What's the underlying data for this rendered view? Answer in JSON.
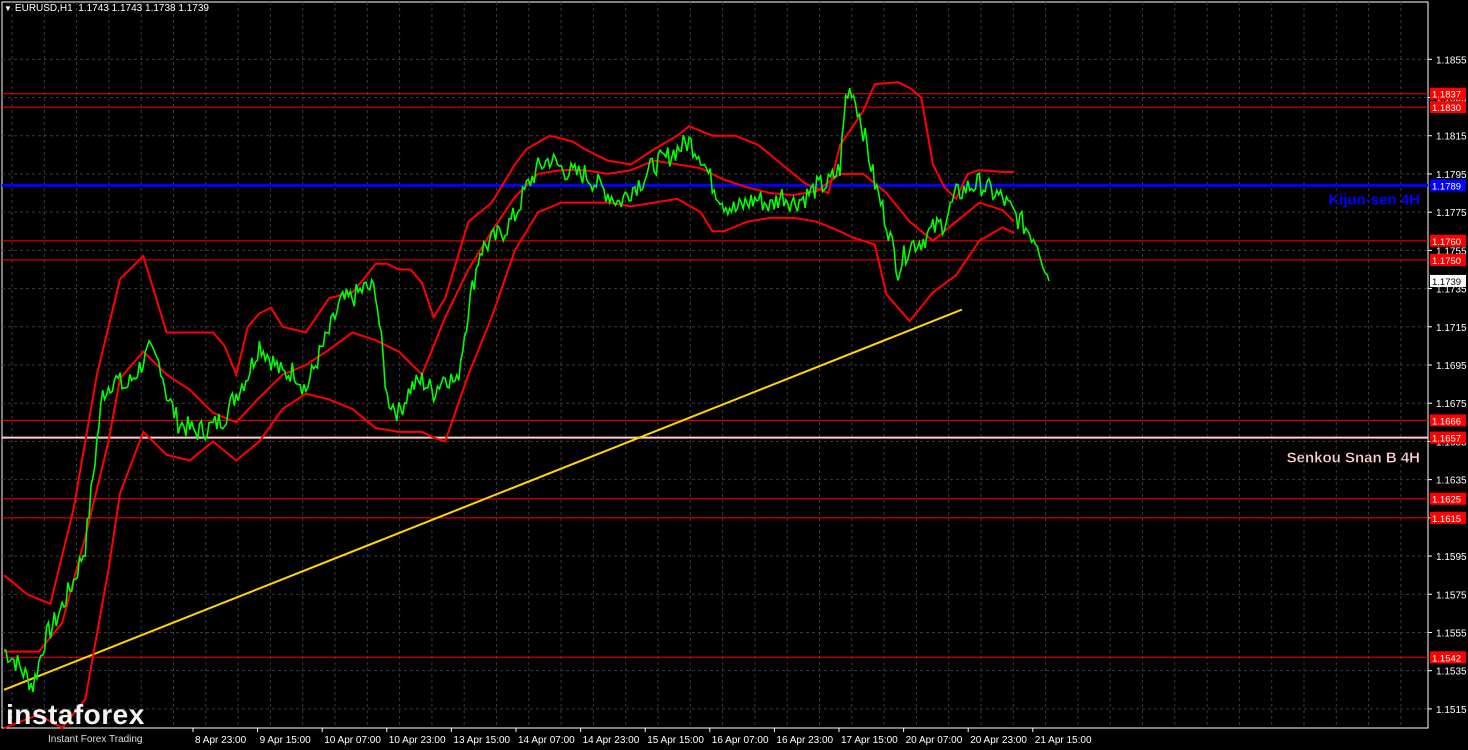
{
  "header": {
    "symbol": "EURUSD,H1",
    "ohlc": "1.1743 1.1743 1.1738 1.1739"
  },
  "logo": {
    "name": "instaforex",
    "tagline": "Instant Forex Trading"
  },
  "colors": {
    "background": "#000000",
    "grid": "#3a3a3a",
    "candles": "#00ff00",
    "bands": "#ff0000",
    "levels": "#ff0000",
    "kijun": "#0000ff",
    "senkou": "#ffd0d0",
    "trend": "#ffd700",
    "axis_text": "#ffffff"
  },
  "chart_data": {
    "type": "line",
    "symbol": "EURUSD",
    "timeframe": "H1",
    "ylim": [
      1.1505,
      1.1885
    ],
    "y_ticks": [
      "1.1855",
      "1.1835",
      "1.1815",
      "1.1795",
      "1.1775",
      "1.1755",
      "1.1735",
      "1.1715",
      "1.1695",
      "1.1675",
      "1.1655",
      "1.1635",
      "1.1615",
      "1.1595",
      "1.1575",
      "1.1555",
      "1.1535",
      "1.1515"
    ],
    "x_labels": [
      "8 Apr 23:00",
      "9 Apr 15:00",
      "10 Apr 07:00",
      "10 Apr 23:00",
      "13 Apr 15:00",
      "14 Apr 07:00",
      "14 Apr 23:00",
      "15 Apr 15:00",
      "16 Apr 07:00",
      "16 Apr 23:00",
      "17 Apr 15:00",
      "20 Apr 07:00",
      "20 Apr 23:00",
      "21 Apr 15:00"
    ],
    "horizontal_levels": [
      {
        "label": "1.1837",
        "value": 1.1837
      },
      {
        "label": "1.1830",
        "value": 1.183
      },
      {
        "label": "1.1760",
        "value": 1.176
      },
      {
        "label": "1.1750",
        "value": 1.175
      },
      {
        "label": "1.1666",
        "value": 1.1666
      },
      {
        "label": "1.1625",
        "value": 1.1625
      },
      {
        "label": "1.1615",
        "value": 1.1615
      },
      {
        "label": "1.1542",
        "value": 1.1542
      }
    ],
    "kijun": {
      "label": "Kijun-sen 4H",
      "value": 1.1789,
      "price_label": "1.1789"
    },
    "senkou": {
      "label": "Senkou Snan B 4H",
      "value": 1.1657,
      "price_label": "1.1657"
    },
    "current_price": {
      "label": "1.1739",
      "value": 1.1739
    },
    "trendline": {
      "from": [
        0,
        1.1525
      ],
      "to": [
        165,
        1.1724
      ]
    },
    "price_path": [
      [
        0,
        1.1546
      ],
      [
        2,
        1.154
      ],
      [
        5,
        1.1527
      ],
      [
        7,
        1.1551
      ],
      [
        9,
        1.1562
      ],
      [
        12,
        1.1582
      ],
      [
        14,
        1.16
      ],
      [
        16,
        1.1655
      ],
      [
        17,
        1.168
      ],
      [
        19,
        1.1688
      ],
      [
        21,
        1.1683
      ],
      [
        23,
        1.1692
      ],
      [
        25,
        1.1702
      ],
      [
        27,
        1.1695
      ],
      [
        28,
        1.168
      ],
      [
        30,
        1.1665
      ],
      [
        33,
        1.166
      ],
      [
        36,
        1.1663
      ],
      [
        38,
        1.1668
      ],
      [
        40,
        1.168
      ],
      [
        42,
        1.169
      ],
      [
        44,
        1.1706
      ],
      [
        46,
        1.1698
      ],
      [
        48,
        1.169
      ],
      [
        50,
        1.1692
      ],
      [
        52,
        1.1682
      ],
      [
        54,
        1.1698
      ],
      [
        56,
        1.1712
      ],
      [
        58,
        1.1728
      ],
      [
        60,
        1.173
      ],
      [
        62,
        1.1735
      ],
      [
        64,
        1.1735
      ],
      [
        66,
        1.1678
      ],
      [
        68,
        1.167
      ],
      [
        70,
        1.1683
      ],
      [
        72,
        1.1687
      ],
      [
        74,
        1.1681
      ],
      [
        76,
        1.169
      ],
      [
        78,
        1.1685
      ],
      [
        80,
        1.1725
      ],
      [
        82,
        1.1755
      ],
      [
        84,
        1.176
      ],
      [
        86,
        1.1765
      ],
      [
        88,
        1.1773
      ],
      [
        90,
        1.1788
      ],
      [
        92,
        1.1798
      ],
      [
        94,
        1.1803
      ],
      [
        96,
        1.1798
      ],
      [
        98,
        1.1795
      ],
      [
        100,
        1.1795
      ],
      [
        102,
        1.179
      ],
      [
        104,
        1.1785
      ],
      [
        106,
        1.178
      ],
      [
        108,
        1.1787
      ],
      [
        110,
        1.1792
      ],
      [
        112,
        1.18
      ],
      [
        114,
        1.1803
      ],
      [
        116,
        1.1808
      ],
      [
        118,
        1.1812
      ],
      [
        120,
        1.1805
      ],
      [
        122,
        1.179
      ],
      [
        124,
        1.178
      ],
      [
        126,
        1.1776
      ],
      [
        128,
        1.178
      ],
      [
        130,
        1.1782
      ],
      [
        132,
        1.1778
      ],
      [
        134,
        1.1784
      ],
      [
        136,
        1.178
      ],
      [
        138,
        1.1783
      ],
      [
        140,
        1.1788
      ],
      [
        142,
        1.179
      ],
      [
        144,
        1.1798
      ],
      [
        145,
        1.1835
      ],
      [
        146,
        1.184
      ],
      [
        147,
        1.183
      ],
      [
        148,
        1.1818
      ],
      [
        150,
        1.179
      ],
      [
        152,
        1.177
      ],
      [
        154,
        1.1745
      ],
      [
        156,
        1.1758
      ],
      [
        158,
        1.176
      ],
      [
        160,
        1.1766
      ],
      [
        162,
        1.177
      ],
      [
        164,
        1.1784
      ],
      [
        166,
        1.1788
      ],
      [
        168,
        1.179
      ],
      [
        170,
        1.1786
      ],
      [
        172,
        1.1782
      ],
      [
        174,
        1.1774
      ],
      [
        176,
        1.1767
      ],
      [
        178,
        1.176
      ],
      [
        180,
        1.1739
      ]
    ],
    "bands": {
      "upper": [
        [
          0,
          1.1585
        ],
        [
          4,
          1.1575
        ],
        [
          8,
          1.157
        ],
        [
          12,
          1.162
        ],
        [
          16,
          1.169
        ],
        [
          20,
          1.174
        ],
        [
          24,
          1.1752
        ],
        [
          28,
          1.1712
        ],
        [
          32,
          1.1712
        ],
        [
          36,
          1.1712
        ],
        [
          38,
          1.1705
        ],
        [
          40,
          1.169
        ],
        [
          42,
          1.1715
        ],
        [
          44,
          1.1722
        ],
        [
          46,
          1.1725
        ],
        [
          48,
          1.1715
        ],
        [
          52,
          1.1712
        ],
        [
          56,
          1.173
        ],
        [
          60,
          1.1733
        ],
        [
          62,
          1.174
        ],
        [
          64,
          1.1748
        ],
        [
          66,
          1.1748
        ],
        [
          68,
          1.1745
        ],
        [
          70,
          1.1745
        ],
        [
          72,
          1.1738
        ],
        [
          74,
          1.172
        ],
        [
          76,
          1.173
        ],
        [
          80,
          1.177
        ],
        [
          84,
          1.178
        ],
        [
          86,
          1.179
        ],
        [
          88,
          1.18
        ],
        [
          90,
          1.1808
        ],
        [
          94,
          1.1815
        ],
        [
          98,
          1.1812
        ],
        [
          100,
          1.1808
        ],
        [
          104,
          1.1802
        ],
        [
          108,
          1.18
        ],
        [
          112,
          1.1808
        ],
        [
          116,
          1.1815
        ],
        [
          118,
          1.182
        ],
        [
          122,
          1.1815
        ],
        [
          126,
          1.1815
        ],
        [
          130,
          1.181
        ],
        [
          134,
          1.18
        ],
        [
          138,
          1.179
        ],
        [
          142,
          1.1785
        ],
        [
          144,
          1.181
        ],
        [
          148,
          1.1828
        ],
        [
          150,
          1.1842
        ],
        [
          154,
          1.1843
        ],
        [
          156,
          1.184
        ],
        [
          158,
          1.1835
        ],
        [
          160,
          1.18
        ],
        [
          162,
          1.1788
        ],
        [
          164,
          1.1782
        ],
        [
          166,
          1.1795
        ],
        [
          168,
          1.1797
        ],
        [
          172,
          1.1796
        ],
        [
          174,
          1.1796
        ]
      ],
      "middle": [
        [
          0,
          1.1545
        ],
        [
          6,
          1.1545
        ],
        [
          10,
          1.156
        ],
        [
          14,
          1.1605
        ],
        [
          18,
          1.1655
        ],
        [
          20,
          1.1688
        ],
        [
          24,
          1.1702
        ],
        [
          28,
          1.169
        ],
        [
          32,
          1.1682
        ],
        [
          36,
          1.167
        ],
        [
          40,
          1.1665
        ],
        [
          44,
          1.1678
        ],
        [
          48,
          1.169
        ],
        [
          52,
          1.1695
        ],
        [
          56,
          1.1703
        ],
        [
          60,
          1.1712
        ],
        [
          64,
          1.1708
        ],
        [
          68,
          1.1702
        ],
        [
          72,
          1.169
        ],
        [
          76,
          1.172
        ],
        [
          80,
          1.1745
        ],
        [
          84,
          1.1765
        ],
        [
          88,
          1.1783
        ],
        [
          92,
          1.1795
        ],
        [
          96,
          1.1797
        ],
        [
          100,
          1.1797
        ],
        [
          104,
          1.1795
        ],
        [
          108,
          1.1797
        ],
        [
          112,
          1.1802
        ],
        [
          116,
          1.18
        ],
        [
          120,
          1.1798
        ],
        [
          124,
          1.1792
        ],
        [
          128,
          1.1788
        ],
        [
          132,
          1.1785
        ],
        [
          136,
          1.1784
        ],
        [
          140,
          1.1786
        ],
        [
          144,
          1.1795
        ],
        [
          148,
          1.1795
        ],
        [
          152,
          1.1785
        ],
        [
          156,
          1.177
        ],
        [
          160,
          1.176
        ],
        [
          164,
          1.177
        ],
        [
          168,
          1.178
        ],
        [
          172,
          1.1776
        ],
        [
          174,
          1.177
        ]
      ],
      "lower": [
        [
          0,
          1.1505
        ],
        [
          6,
          1.1512
        ],
        [
          10,
          1.1505
        ],
        [
          14,
          1.152
        ],
        [
          18,
          1.1588
        ],
        [
          20,
          1.1628
        ],
        [
          24,
          1.166
        ],
        [
          28,
          1.1648
        ],
        [
          32,
          1.1645
        ],
        [
          36,
          1.1655
        ],
        [
          40,
          1.1645
        ],
        [
          44,
          1.1655
        ],
        [
          48,
          1.1672
        ],
        [
          52,
          1.168
        ],
        [
          56,
          1.1677
        ],
        [
          60,
          1.1672
        ],
        [
          64,
          1.1662
        ],
        [
          68,
          1.166
        ],
        [
          72,
          1.166
        ],
        [
          74,
          1.1657
        ],
        [
          76,
          1.1655
        ],
        [
          80,
          1.169
        ],
        [
          84,
          1.172
        ],
        [
          88,
          1.1755
        ],
        [
          92,
          1.1775
        ],
        [
          96,
          1.178
        ],
        [
          100,
          1.178
        ],
        [
          104,
          1.178
        ],
        [
          108,
          1.1778
        ],
        [
          112,
          1.178
        ],
        [
          116,
          1.1782
        ],
        [
          120,
          1.1775
        ],
        [
          122,
          1.1765
        ],
        [
          124,
          1.1765
        ],
        [
          128,
          1.177
        ],
        [
          132,
          1.1772
        ],
        [
          136,
          1.1772
        ],
        [
          140,
          1.177
        ],
        [
          144,
          1.1765
        ],
        [
          146,
          1.1762
        ],
        [
          150,
          1.1758
        ],
        [
          152,
          1.1732
        ],
        [
          156,
          1.1718
        ],
        [
          160,
          1.1733
        ],
        [
          164,
          1.1742
        ],
        [
          168,
          1.176
        ],
        [
          172,
          1.1767
        ],
        [
          174,
          1.1764
        ]
      ]
    }
  }
}
